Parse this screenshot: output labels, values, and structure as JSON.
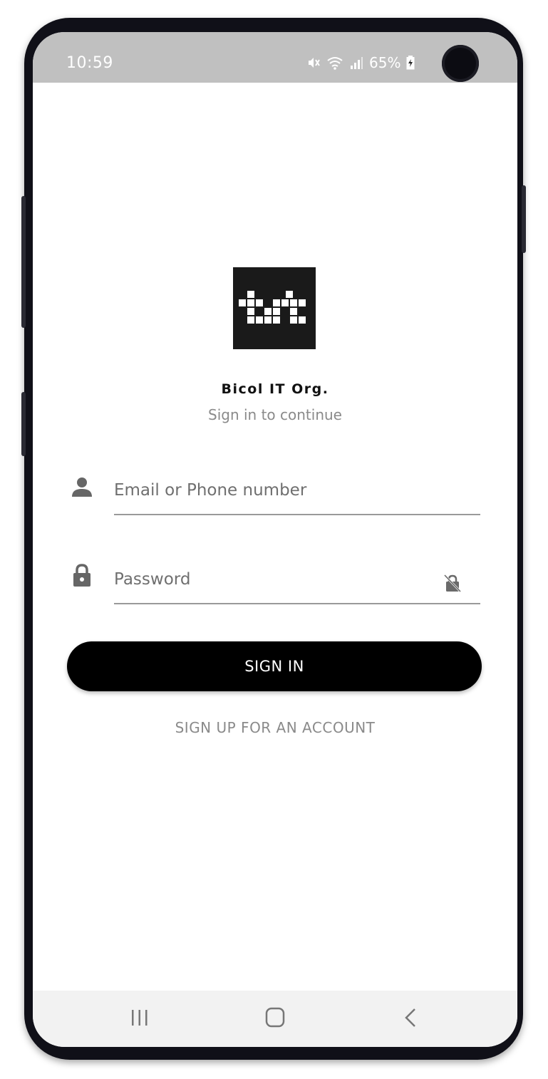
{
  "status_bar": {
    "time": "10:59",
    "battery_percent": "65%",
    "icons": [
      "mute-icon",
      "wifi-icon",
      "signal-icon",
      "battery-charging-icon"
    ]
  },
  "app": {
    "logo_text": "bit",
    "org_name": "Bicol IT Org.",
    "subtitle": "Sign in to continue"
  },
  "form": {
    "email_placeholder": "Email or Phone number",
    "password_placeholder": "Password",
    "email_icon": "person-icon",
    "password_icon": "lock-icon",
    "visibility_icon": "visibility-off-icon"
  },
  "actions": {
    "signin_label": "SIGN IN",
    "signup_label": "SIGN UP FOR AN ACCOUNT"
  },
  "navbar": {
    "buttons": [
      "recent-apps-icon",
      "home-icon",
      "back-icon"
    ]
  },
  "colors": {
    "status_bar": "#c0c0c0",
    "primary_button": "#000000",
    "muted_text": "#8a8a8a",
    "underline": "#9a9a9a"
  }
}
